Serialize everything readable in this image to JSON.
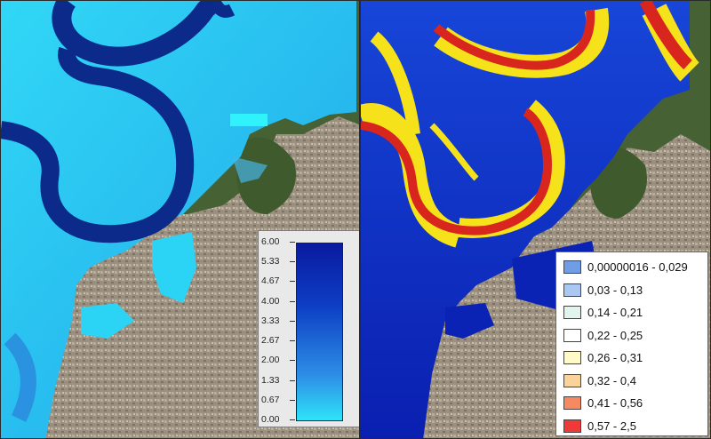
{
  "depth_legend": {
    "ticks": [
      "6.00",
      "5.33",
      "4.67",
      "4.00",
      "3.33",
      "2.67",
      "2.00",
      "1.33",
      "0.67",
      "0.00"
    ],
    "ramp_colors": [
      "#0a1aa0",
      "#0d3ec4",
      "#2d8fe6",
      "#2fe3f8"
    ]
  },
  "velocity_legend": {
    "classes": [
      {
        "label": "0,00000016 - 0,029",
        "color": "#6f9de6"
      },
      {
        "label": "0,03 - 0,13",
        "color": "#a9c9f2"
      },
      {
        "label": "0,14 - 0,21",
        "color": "#e1f4ee"
      },
      {
        "label": "0,22 - 0,25",
        "color": "#ffffff"
      },
      {
        "label": "0,26 - 0,31",
        "color": "#fffac8"
      },
      {
        "label": "0,32 - 0,4",
        "color": "#fbd39a"
      },
      {
        "label": "0,41 - 0,56",
        "color": "#f58a62"
      },
      {
        "label": "0,57 - 2,5",
        "color": "#f03a3a"
      }
    ]
  },
  "colors": {
    "flood_depth": "#2fd7f5",
    "channel_deep": "#0b2a8a",
    "velocity_low": "#0b2fd0",
    "velocity_mid": "#f5e21a",
    "velocity_high": "#d8251e",
    "satellite_urban": "#9a8f7f",
    "satellite_green": "#3f5a2a"
  }
}
